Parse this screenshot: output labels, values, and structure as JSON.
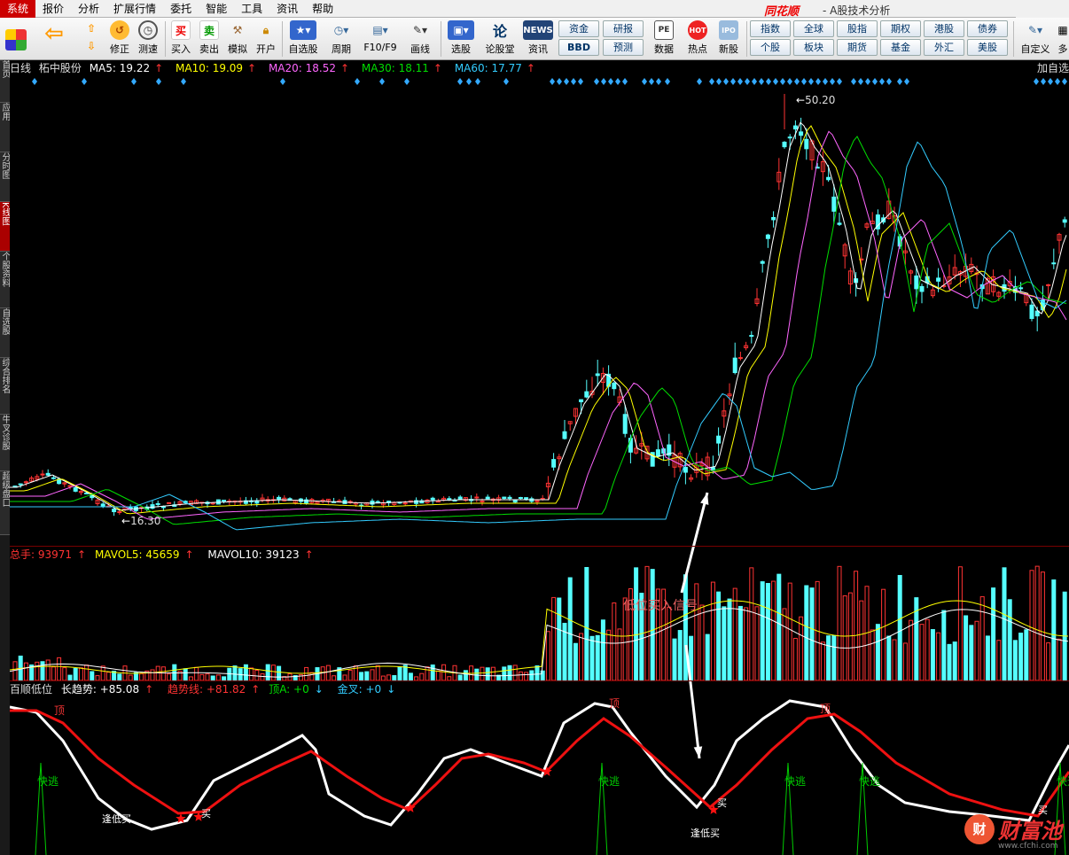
{
  "menu": [
    "系统",
    "报价",
    "分析",
    "扩展行情",
    "委托",
    "智能",
    "工具",
    "资讯",
    "帮助"
  ],
  "brand": {
    "logo": "同花顺",
    "sep": "-",
    "title": "A股技术分析"
  },
  "toolbar": {
    "buttons": [
      "修正",
      "测速",
      "买入",
      "卖出",
      "模拟",
      "开户",
      "自选股",
      "周期",
      "F10/F9",
      "画线",
      "选股",
      "论股堂",
      "资讯",
      "数据",
      "热点",
      "新股",
      "自定义",
      "多"
    ],
    "icon_text": {
      "buy": "买",
      "sell": "卖",
      "news": "NEWS",
      "lun": "论",
      "pe": "PE",
      "hot": "HOT",
      "ipo": "IPO"
    },
    "grid_a": [
      "资金",
      "BBD",
      "研报",
      "预测"
    ],
    "grid_b": [
      "指数",
      "个股",
      "全球",
      "板块",
      "股指",
      "期货",
      "期权",
      "基金",
      "港股",
      "外汇",
      "债券",
      "美股"
    ]
  },
  "left_tabs": [
    "首页",
    "应用",
    "分时图",
    "K线图",
    "个股资料",
    "自选股",
    "综合排名",
    "牛叉诊股",
    "超级盘口"
  ],
  "header": {
    "period": "日线",
    "stock_name": "柘中股份",
    "ma": [
      {
        "label": "MA5: 19.22",
        "color": "#ffffff"
      },
      {
        "label": "MA10: 19.09",
        "color": "#ffff00"
      },
      {
        "label": "MA20: 18.52",
        "color": "#ff66ff"
      },
      {
        "label": "MA30: 18.11",
        "color": "#00dd00"
      },
      {
        "label": "MA60: 17.77",
        "color": "#33ccff"
      }
    ],
    "add_watch": "加自选"
  },
  "price_labels": {
    "high": "50.20",
    "low": "16.30"
  },
  "volume": {
    "total": {
      "label": "总手: 93971",
      "color": "#ff3333"
    },
    "mavol5": {
      "label": "MAVOL5: 45659",
      "color": "#ffff00"
    },
    "mavol10": {
      "label": "MAVOL10: 39123",
      "color": "#ffffff"
    }
  },
  "indicator": {
    "name": "百顺低位",
    "long_trend": "长趋势: +85.08",
    "trend_line": "趋势线: +81.82",
    "top_a": "顶A: +0",
    "golden_cross": "金叉: +0"
  },
  "annotation": "低位买入信号",
  "indicator_marks": {
    "top": "顶",
    "escape": "快逃",
    "low": "逢低买",
    "buy": "买"
  },
  "watermark": {
    "text": "财富池",
    "url": "www.cfchi.com",
    "char": "财"
  },
  "colors": {
    "up": "#ff3333",
    "down": "#55ffff",
    "bg": "#000000"
  }
}
